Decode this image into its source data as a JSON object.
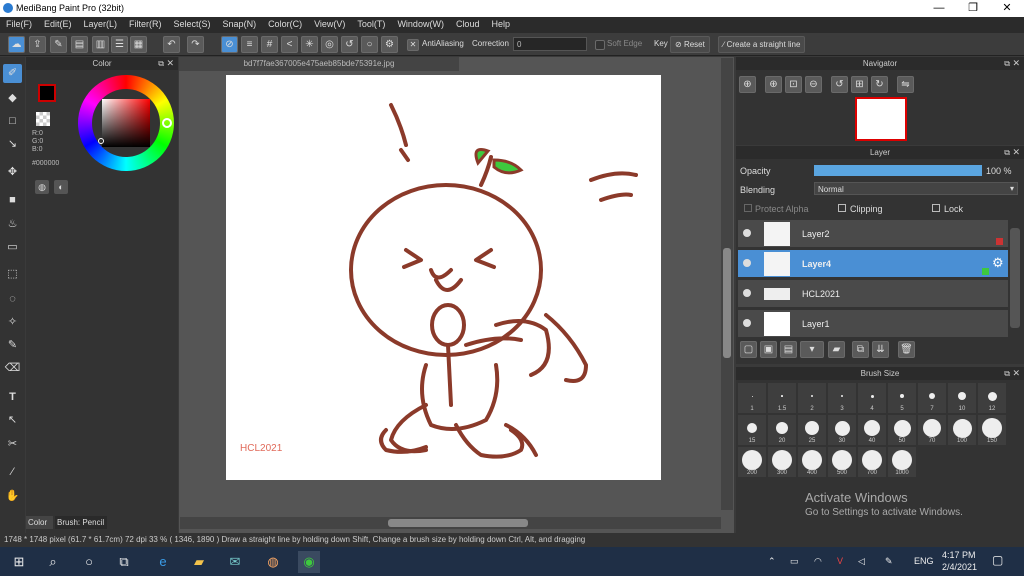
{
  "window": {
    "title": "MediBang Paint Pro (32bit)",
    "minimize": "—",
    "maximize": "❐",
    "close": "✕"
  },
  "menu": [
    "File(F)",
    "Edit(E)",
    "Layer(L)",
    "Filter(R)",
    "Select(S)",
    "Snap(N)",
    "Color(C)",
    "View(V)",
    "Tool(T)",
    "Window(W)",
    "Cloud",
    "Help"
  ],
  "toolbar": {
    "antialiasing_label": "AntiAliasing",
    "correction_label": "Correction",
    "correction_value": "0",
    "soft_edge_label": "Soft Edge",
    "key_label": "Key",
    "reset_label": "Reset",
    "straight_line_label": "Create a straight line"
  },
  "color_panel": {
    "title": "Color",
    "r": "R:0",
    "g": "G:0",
    "b": "B:0",
    "hex": "#000000",
    "tab_color": "Color",
    "tab_brush": "Brush: Pencil",
    "main_color": "#000000",
    "accent": "#cc0000"
  },
  "document": {
    "tab_name": "bd7f7fae367005e475aeb85bde75391e.jpg",
    "signature": "HCL2021"
  },
  "navigator": {
    "title": "Navigator"
  },
  "layer_panel": {
    "title": "Layer",
    "opacity_label": "Opacity",
    "opacity_value": "100 %",
    "opacity_fraction": 1.0,
    "blending_label": "Blending",
    "blending_value": "Normal",
    "protect_alpha": "Protect Alpha",
    "clipping": "Clipping",
    "lock": "Lock",
    "layers": [
      {
        "name": "Layer2",
        "selected": false
      },
      {
        "name": "Layer4",
        "selected": true
      },
      {
        "name": "HCL2021",
        "selected": false
      },
      {
        "name": "Layer1",
        "selected": false
      }
    ]
  },
  "brush_size": {
    "title": "Brush Size",
    "sizes": [
      "1",
      "1.5",
      "2",
      "3",
      "4",
      "5",
      "7",
      "10",
      "12",
      "15",
      "20",
      "25",
      "30",
      "40",
      "50",
      "70",
      "100",
      "150",
      "200",
      "300",
      "400",
      "500",
      "700",
      "1000"
    ]
  },
  "status": {
    "text": "1748 * 1748 pixel  (61.7 * 61.7cm)  72 dpi  33 %  ( 1346, 1890 )  Draw a straight line by holding down Shift, Change a brush size by holding down Ctrl, Alt, and dragging"
  },
  "watermark": {
    "line1": "Activate Windows",
    "line2": "Go to Settings to activate Windows."
  },
  "taskbar": {
    "language": "ENG",
    "time": "4:17 PM",
    "date": "2/4/2021"
  },
  "drawing": {
    "stroke_color": "#8b3a2a",
    "sprout_color": "#3ec93e"
  }
}
